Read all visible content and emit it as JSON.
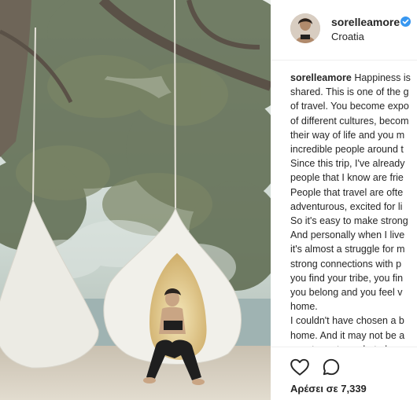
{
  "post": {
    "username": "sorelleamore",
    "location": "Croatia",
    "verified": true,
    "caption_lines": [
      "Happiness is",
      "shared. This is one of the g",
      "of travel. You become expo",
      "of different cultures, becom",
      "their way of life and you m",
      "incredible people around t",
      "Since this trip, I've already",
      "people that I know are frie",
      "People that travel are ofte",
      "adventurous, excited for li",
      "So it's easy to make strong",
      "And personally when I live",
      "it's almost a struggle for m",
      "strong connections with p",
      "you find your tribe, you fin",
      "you belong and you feel v",
      "home.",
      "I couldn't have chosen a b",
      "home. And it may not be a",
      "country or town, but plane"
    ],
    "likes_text": "Αρέσει σε 7,339"
  },
  "icons": {
    "like": "heart-icon",
    "comment": "comment-icon",
    "verified": "verified-badge-icon"
  },
  "colors": {
    "text": "#262626",
    "verified_blue": "#3897f0",
    "divider": "#efefef"
  }
}
